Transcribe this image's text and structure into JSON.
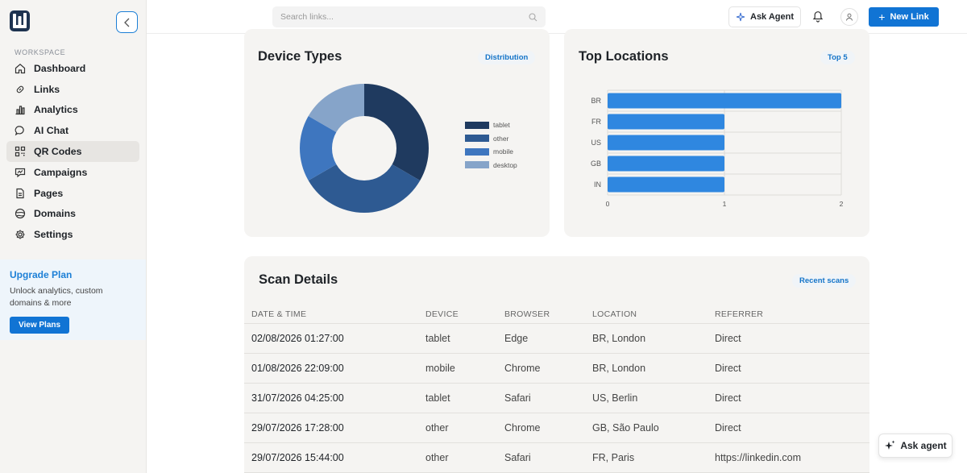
{
  "sidebar": {
    "workspace_label": "WORKSPACE",
    "items": [
      {
        "label": "Dashboard",
        "icon": "home-icon"
      },
      {
        "label": "Links",
        "icon": "link-icon"
      },
      {
        "label": "Analytics",
        "icon": "bar-chart-icon"
      },
      {
        "label": "AI Chat",
        "icon": "chat-icon"
      },
      {
        "label": "QR Codes",
        "icon": "qr-code-icon",
        "active": true
      },
      {
        "label": "Campaigns",
        "icon": "campaign-icon"
      },
      {
        "label": "Pages",
        "icon": "page-icon"
      },
      {
        "label": "Domains",
        "icon": "globe-icon"
      },
      {
        "label": "Settings",
        "icon": "gear-icon"
      }
    ],
    "upgrade": {
      "title": "Upgrade Plan",
      "text": "Unlock analytics, custom domains & more",
      "button": "View Plans"
    }
  },
  "header": {
    "search_placeholder": "Search links...",
    "ask_agent": "Ask Agent",
    "new_link": "New Link"
  },
  "device_types": {
    "title": "Device Types",
    "pill": "Distribution"
  },
  "top_locations": {
    "title": "Top Locations",
    "pill": "Top 5"
  },
  "scan_details": {
    "title": "Scan Details",
    "pill": "Recent scans",
    "columns": [
      "DATE & TIME",
      "DEVICE",
      "BROWSER",
      "LOCATION",
      "REFERRER"
    ],
    "rows": [
      [
        "02/08/2026 01:27:00",
        "tablet",
        "Edge",
        "BR, London",
        "Direct"
      ],
      [
        "01/08/2026 22:09:00",
        "mobile",
        "Chrome",
        "BR, London",
        "Direct"
      ],
      [
        "31/07/2026 04:25:00",
        "tablet",
        "Safari",
        "US, Berlin",
        "Direct"
      ],
      [
        "29/07/2026 17:28:00",
        "other",
        "Chrome",
        "GB, São Paulo",
        "Direct"
      ],
      [
        "29/07/2026 15:44:00",
        "other",
        "Safari",
        "FR, Paris",
        "https://linkedin.com"
      ]
    ]
  },
  "float_agent": "Ask agent",
  "colors": {
    "accent": "#1174d4",
    "tablet": "#1f3a5f",
    "other": "#2e5a92",
    "mobile": "#3e76bf",
    "desktop": "#86a4c9",
    "bar": "#2f87e0"
  },
  "chart_data": [
    {
      "type": "pie",
      "variant": "donut",
      "title": "Device Types",
      "categories": [
        "tablet",
        "other",
        "mobile",
        "desktop"
      ],
      "values": [
        2,
        2,
        1,
        1
      ],
      "legend": "right"
    },
    {
      "type": "bar",
      "orientation": "horizontal",
      "title": "Top Locations",
      "categories": [
        "BR",
        "FR",
        "US",
        "GB",
        "IN"
      ],
      "values": [
        2,
        1,
        1,
        1,
        1
      ],
      "xlim": [
        0,
        2
      ],
      "xticks": [
        "0",
        "1",
        "2"
      ],
      "grid": true
    }
  ]
}
